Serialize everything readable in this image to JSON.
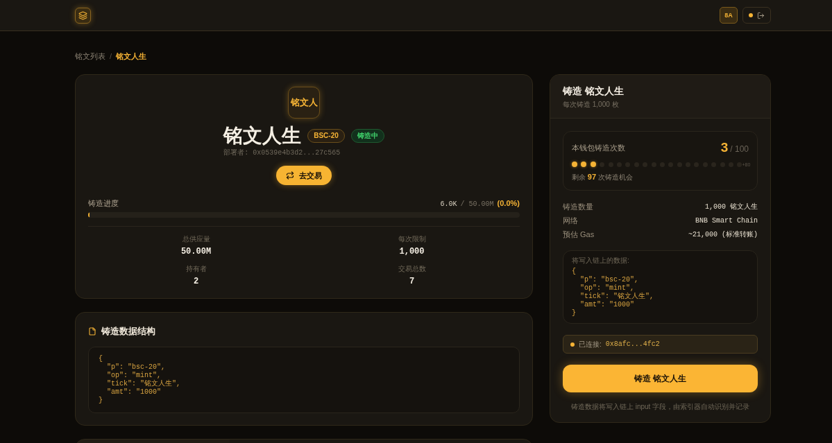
{
  "header": {
    "account": "8A"
  },
  "breadcrumb": {
    "separator": "/",
    "items": [
      {
        "label": "铭文列表",
        "selected": false
      },
      {
        "label": "铭文人生",
        "selected": true
      }
    ]
  },
  "token": {
    "logo_text": "铭文人",
    "name": "铭文人生",
    "badges": [
      {
        "label": "BSC-20",
        "kind": "standard"
      },
      {
        "label": "铸造中",
        "kind": "status"
      }
    ],
    "deployer": "部署者: 0x0539e4b3d2...27c565",
    "trade_button": "去交易"
  },
  "progress": {
    "label": "铸造进度",
    "minted": "6.0K",
    "total": "/ 50.00M",
    "percent": "(0.0%)",
    "level": 0.003
  },
  "stats": [
    {
      "label": "总供应量",
      "value": "50.00M"
    },
    {
      "label": "每次限制",
      "value": "1,000"
    },
    {
      "label": "持有者",
      "value": "2"
    },
    {
      "label": "交易总数",
      "value": "7"
    }
  ],
  "data_structure": {
    "title": "铸造数据结构",
    "code": "{\n  \"p\": \"bsc-20\",\n  \"op\": \"mint\",\n  \"tick\": \"铭文人生\",\n  \"amt\": \"1000\"\n}"
  },
  "mint_panel": {
    "title": "铸造 铭文人生",
    "subtitle": "每次铸造 1,000 枚",
    "wallet_mints": {
      "label": "本钱包铸造次数",
      "count": "3",
      "limit": "/ 100",
      "dots": [
        {
          "filled": true
        },
        {
          "filled": true
        },
        {
          "filled": true
        },
        {
          "filled": false
        },
        {
          "filled": false
        },
        {
          "filled": false
        },
        {
          "filled": false
        },
        {
          "filled": false
        },
        {
          "filled": false
        },
        {
          "filled": false
        },
        {
          "filled": false
        },
        {
          "filled": false
        },
        {
          "filled": false
        },
        {
          "filled": false
        },
        {
          "filled": false
        },
        {
          "filled": false
        },
        {
          "filled": false
        },
        {
          "filled": false
        },
        {
          "filled": false
        },
        {
          "filled": false
        }
      ],
      "more": "+80",
      "remaining": "剩余 **97** 次铸造机会"
    },
    "details": [
      {
        "label": "铸造数量",
        "value": "1,000 铭文人生"
      },
      {
        "label": "网络",
        "value": "BNB Smart Chain"
      },
      {
        "label": "预估 Gas",
        "value": "~21,000 (标准转账)"
      }
    ],
    "payload_label": "将写入链上的数据:",
    "payload": "{\n  \"p\": \"bsc-20\",\n  \"op\": \"mint\",\n  \"tick\": \"铭文人生\",\n  \"amt\": \"1000\"\n}",
    "connection": {
      "connected": true,
      "label": "已连接:",
      "address": "0x8afc...4fc2"
    },
    "mint_button": "铸造 铭文人生",
    "note": "铸造数据将写入链上 input 字段，由索引器自动识别并记录"
  }
}
